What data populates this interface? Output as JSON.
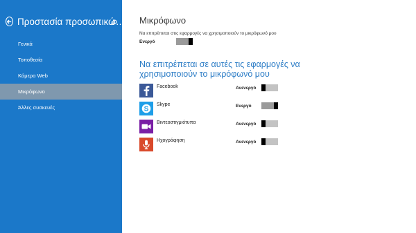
{
  "sidebar": {
    "title": "Προστασία προσωπικώ…",
    "nav": [
      {
        "label": "Γενικά"
      },
      {
        "label": "Τοποθεσία"
      },
      {
        "label": "Κάμερα Web"
      },
      {
        "label": "Μικρόφωνο"
      },
      {
        "label": "Άλλες συσκευές"
      }
    ],
    "active_index": 3
  },
  "main": {
    "title": "Μικρόφωνο",
    "master": {
      "description": "Να επιτρέπεται στις εφαρμογές να χρησιμοποιούν το μικρόφωνό μου",
      "state_label": "Ενεργό",
      "on": true
    },
    "apps_heading": "Να επιτρέπεται σε αυτές τις εφαρμογές να χρησιμοποιούν το μικρόφωνό μου",
    "apps": [
      {
        "name": "Facebook",
        "state_label": "Ανενεργό",
        "on": false,
        "icon": "facebook-icon",
        "color": "#3b5998"
      },
      {
        "name": "Skype",
        "state_label": "Ενεργό",
        "on": true,
        "icon": "skype-icon",
        "color": "#1f9ee8"
      },
      {
        "name": "Βιντεοστιγμιότυπα",
        "state_label": "Ανενεργό",
        "on": false,
        "icon": "video-icon",
        "color": "#7a1fa5"
      },
      {
        "name": "Ηχογράφηση",
        "state_label": "Ανενεργό",
        "on": false,
        "icon": "microphone-icon",
        "color": "#d9492b"
      }
    ]
  },
  "colors": {
    "sidebar_bg": "#1b78c9",
    "nav_active_bg": "#7f98ae",
    "accent_heading": "#2d7dc6"
  }
}
